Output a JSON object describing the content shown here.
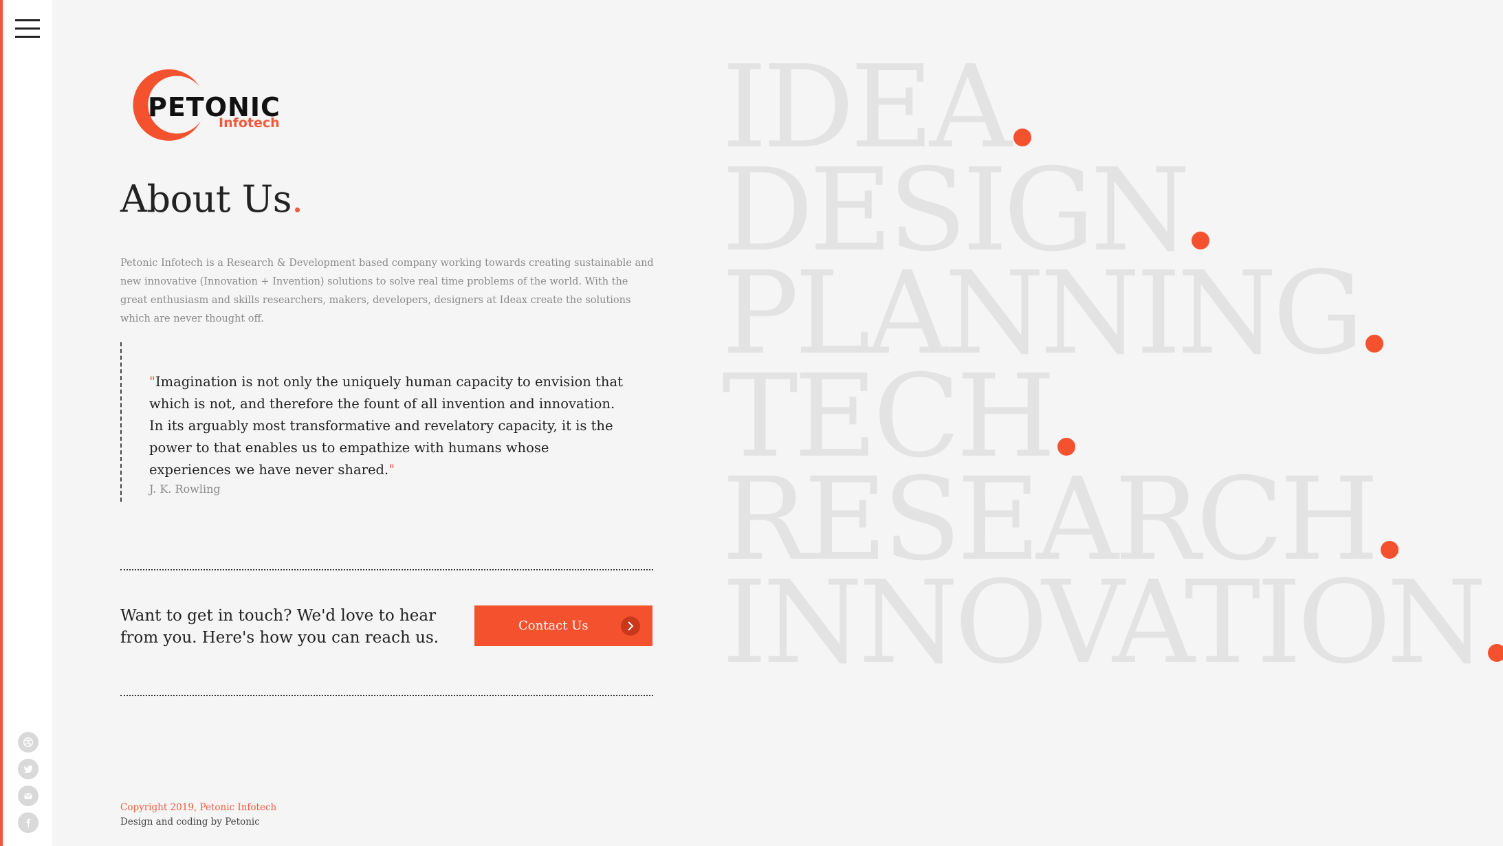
{
  "nav": {
    "menu_icon": "hamburger-menu-icon"
  },
  "social": [
    {
      "name": "dribbble",
      "icon": "dribbble-icon"
    },
    {
      "name": "twitter",
      "icon": "twitter-icon"
    },
    {
      "name": "email",
      "icon": "email-icon"
    },
    {
      "name": "facebook",
      "icon": "facebook-icon"
    }
  ],
  "logo": {
    "name": "PETONIC",
    "sub": "Infotech"
  },
  "about": {
    "title": "About Us",
    "title_dot": ".",
    "intro": "Petonic Infotech is a Research & Development based company working towards creating sustainable and new innovative (Innovation + Invention) solutions to solve real time problems of the world. With the great enthusiasm and skills researchers, makers, developers, designers at Ideax create the solutions which are never thought off."
  },
  "quote": {
    "open": "\"",
    "text": "Imagination is not only the uniquely human capacity to envision that which is not, and therefore the fount of all invention and innovation. In its arguably most transformative and revelatory capacity, it is the power to that enables us to empathize with humans whose experiences we have never shared.",
    "close": "\"",
    "author": "J. K. Rowling"
  },
  "contact": {
    "cta": "Want to get in touch? We'd love to hear from you. Here's how you can reach us.",
    "button_label": "Contact Us"
  },
  "footer": {
    "copyright": "Copyright 2019, Petonic Infotech",
    "credit": "Design and coding by Petonic"
  },
  "big_words": [
    "IDEA",
    "DESIGN",
    "PLANNING",
    "TECH",
    "RESEARCH",
    "INNOVATION"
  ],
  "colors": {
    "accent": "#f4522f",
    "text": "#222222",
    "muted": "#8a8a8a",
    "big_word": "#e3e3e3"
  }
}
